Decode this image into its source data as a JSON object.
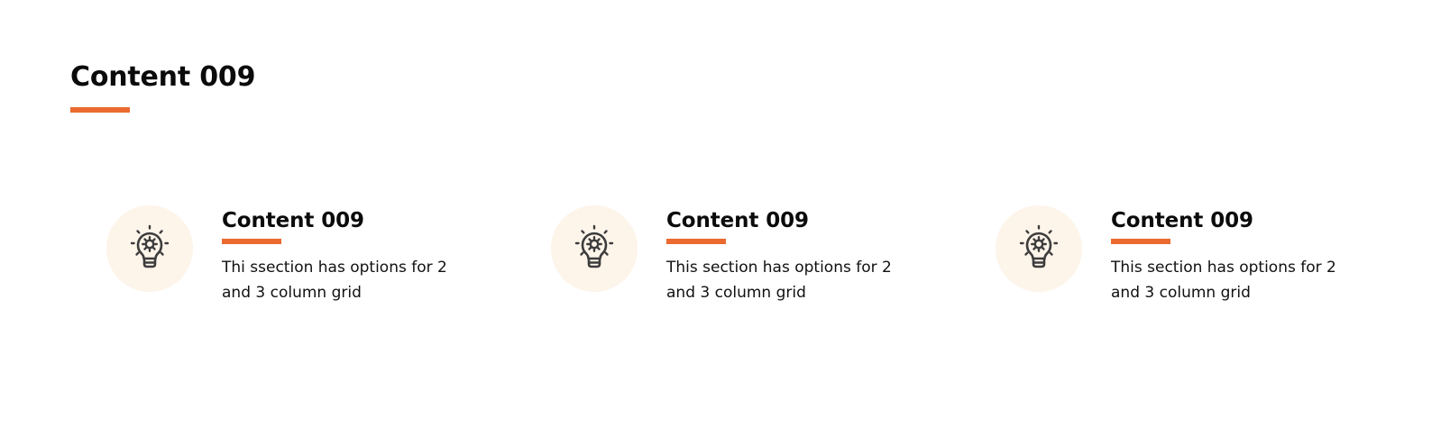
{
  "colors": {
    "accent": "#ea6a2f",
    "icon_bg": "#fdf4ea",
    "icon_stroke": "#3d3d3d",
    "text": "#0b0b0b"
  },
  "section": {
    "title": "Content 009"
  },
  "cards": [
    {
      "icon": "lightbulb-gear-icon",
      "title": "Content 009",
      "text": "Thi ssection has options for 2 and 3 column grid"
    },
    {
      "icon": "lightbulb-gear-icon",
      "title": "Content 009",
      "text": "This section has options for 2 and 3 column grid"
    },
    {
      "icon": "lightbulb-gear-icon",
      "title": "Content 009",
      "text": "This section has options for 2 and 3 column grid"
    }
  ]
}
